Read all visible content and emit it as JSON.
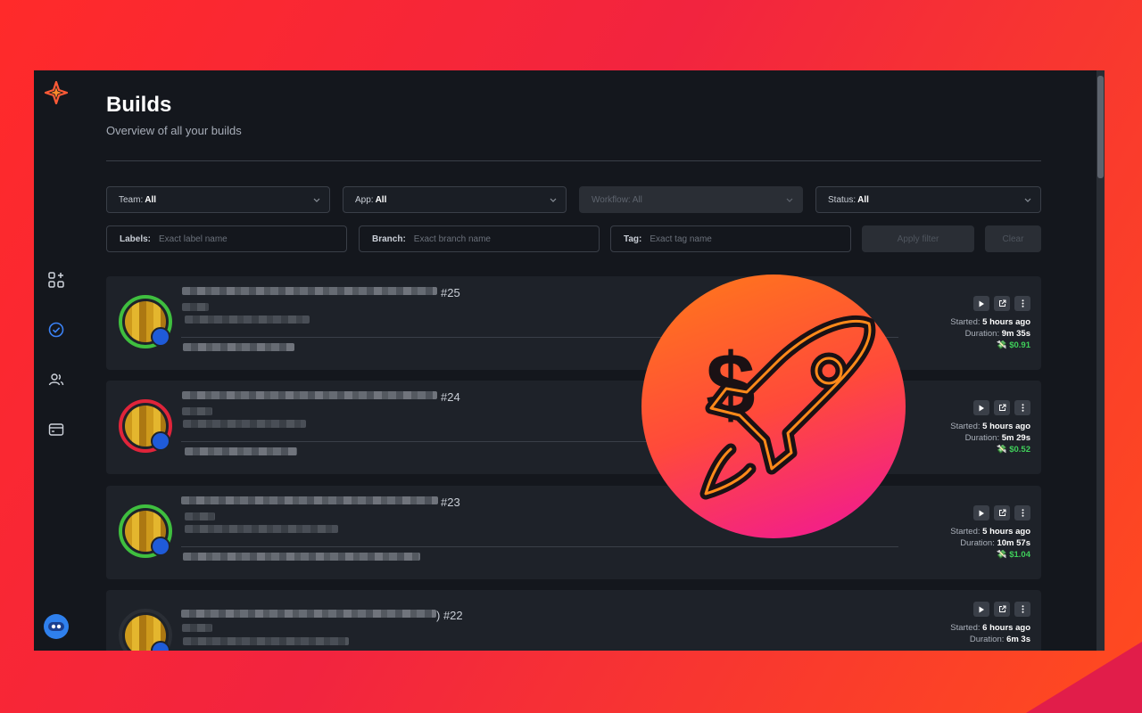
{
  "page": {
    "title": "Builds",
    "subtitle": "Overview of all your builds"
  },
  "filters": {
    "team": {
      "label": "Team:",
      "value": "All"
    },
    "app": {
      "label": "App:",
      "value": "All"
    },
    "workflow": {
      "label": "Workflow:",
      "value": "All",
      "disabled": true
    },
    "status": {
      "label": "Status:",
      "value": "All"
    },
    "labels": {
      "label": "Labels:",
      "placeholder": "Exact label name"
    },
    "branch": {
      "label": "Branch:",
      "placeholder": "Exact branch name"
    },
    "tag": {
      "label": "Tag:",
      "placeholder": "Exact tag name"
    },
    "apply_label": "Apply filter",
    "clear_label": "Clear"
  },
  "builds": [
    {
      "number": "#25",
      "status": "success",
      "started_label": "Started:",
      "started": "5 hours ago",
      "duration_label": "Duration:",
      "duration": "9m 35s",
      "cost": "$0.91"
    },
    {
      "number": "#24",
      "status": "failed",
      "started_label": "Started:",
      "started": "5 hours ago",
      "duration_label": "Duration:",
      "duration": "5m 29s",
      "cost": "$0.52"
    },
    {
      "number": "#23",
      "status": "success",
      "started_label": "Started:",
      "started": "5 hours ago",
      "duration_label": "Duration:",
      "duration": "10m 57s",
      "cost": "$1.04"
    },
    {
      "number": ") #22",
      "status": "running",
      "started_label": "Started:",
      "started": "6 hours ago",
      "duration_label": "Duration:",
      "duration": "6m 3s",
      "cost": ""
    }
  ],
  "colors": {
    "success": "#3fbf3f",
    "failed": "#e0243a",
    "running": "#2a2e35",
    "accent_blue": "#2f6fe0"
  },
  "icons": {
    "logo": "sparkle-logo-icon",
    "nav": [
      "apps-add-icon",
      "check-circle-icon",
      "users-icon",
      "billing-card-icon"
    ],
    "build_actions": [
      "play-icon",
      "external-link-icon",
      "more-vertical-icon"
    ],
    "promo": "rocket-dollar-icon"
  }
}
